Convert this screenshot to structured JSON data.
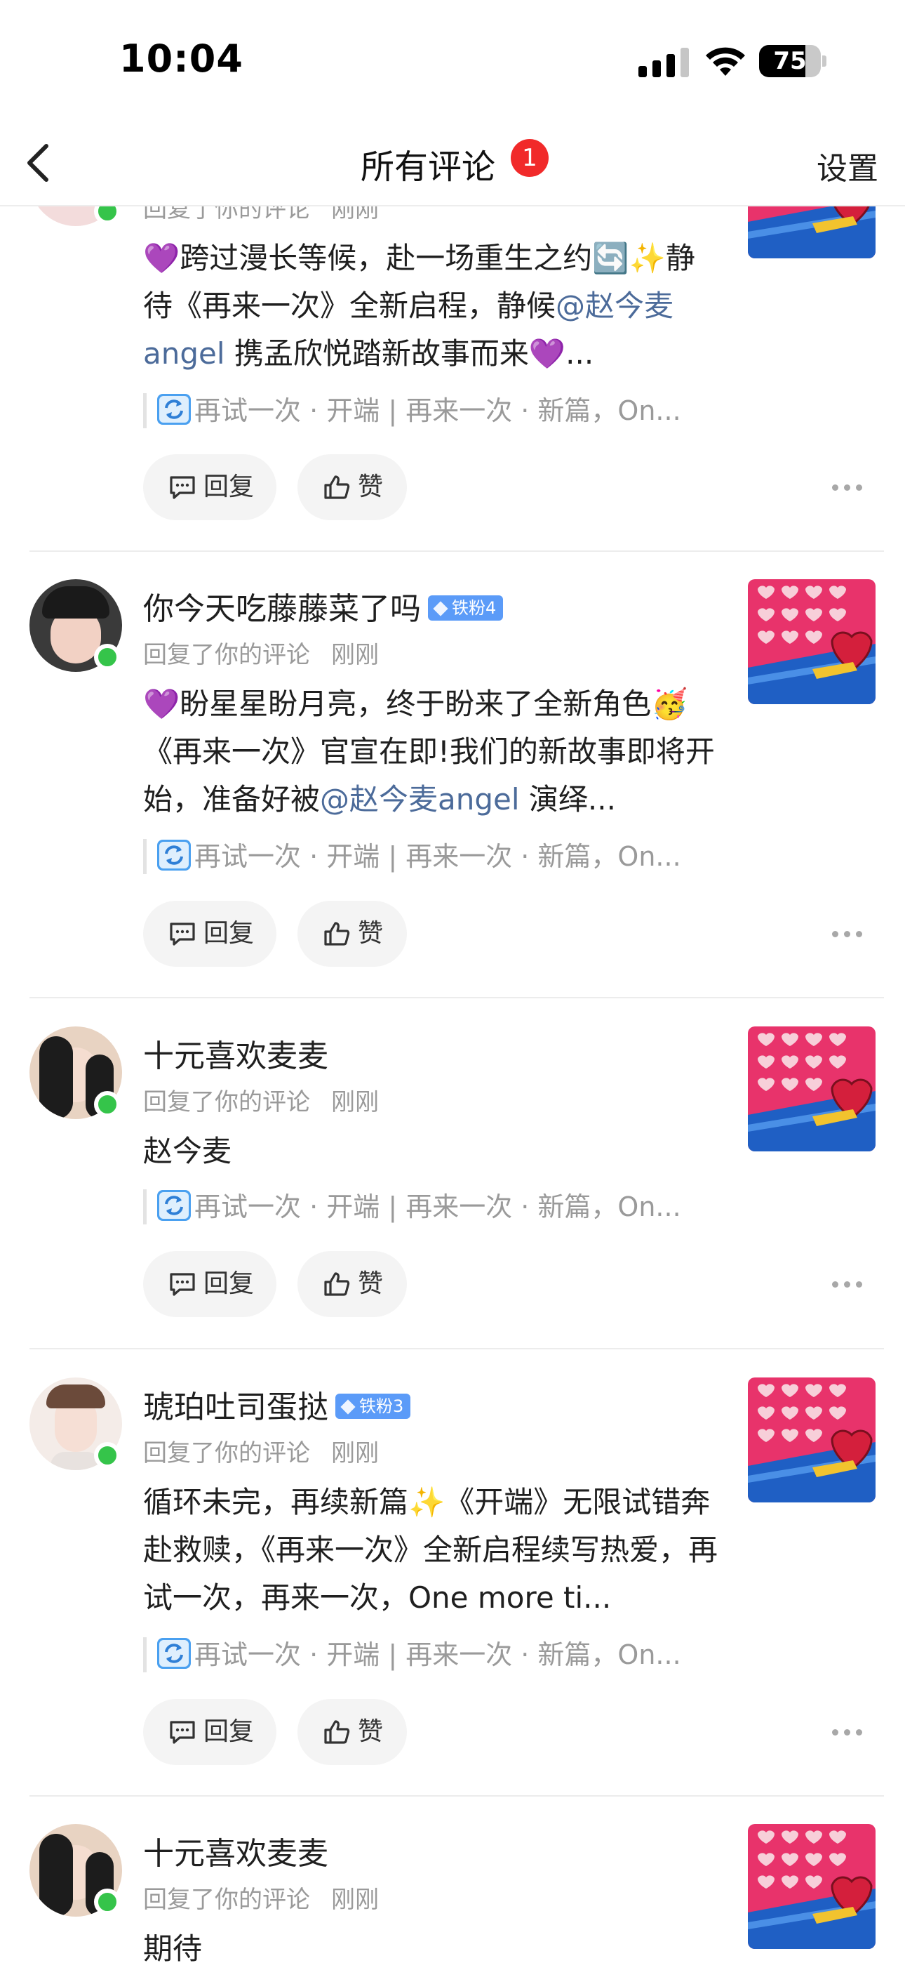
{
  "status_bar": {
    "time": "10:04",
    "battery": "75"
  },
  "nav": {
    "title": "所有评论",
    "badge": "1",
    "settings": "设置"
  },
  "top_partial": {
    "meta_reply": "回复了你的评论",
    "meta_time": "刚刚",
    "text_parts": [
      "💜跨过漫长等候，赴一场重生之约🔄✨静待《再来一次》全新启程，静候",
      "@赵今麦angel",
      "携孟欣悦踏新故事而来💜..."
    ],
    "quote": "再试一次 · 开端 | 再来一次 · 新篇，On...",
    "reply_label": "回复",
    "like_label": "赞"
  },
  "comments": [
    {
      "username": "你今天吃藤藤菜了吗",
      "fan_badge": "铁粉4",
      "meta_reply": "回复了你的评论",
      "meta_time": "刚刚",
      "text_parts": [
        "💜盼星星盼月亮，终于盼来了全新角色🥳《再来一次》官宣在即!我们的新故事即将开始，准备好被",
        "@赵今麦angel",
        "演绎..."
      ],
      "quote": "再试一次 · 开端 | 再来一次 · 新篇，On...",
      "reply_label": "回复",
      "like_label": "赞"
    },
    {
      "username": "十元喜欢麦麦",
      "fan_badge": "",
      "meta_reply": "回复了你的评论",
      "meta_time": "刚刚",
      "text_parts": [
        "赵今麦",
        "",
        ""
      ],
      "quote": "再试一次 · 开端 | 再来一次 · 新篇，On...",
      "reply_label": "回复",
      "like_label": "赞"
    },
    {
      "username": "琥珀吐司蛋挞",
      "fan_badge": "铁粉3",
      "meta_reply": "回复了你的评论",
      "meta_time": "刚刚",
      "text_parts": [
        "循环未完，再续新篇✨《开端》无限试错奔赴救赎，《再来一次》全新启程续写热爱，再试一次，再来一次，One more ti...",
        "",
        ""
      ],
      "quote": "再试一次 · 开端 | 再来一次 · 新篇，On...",
      "reply_label": "回复",
      "like_label": "赞"
    },
    {
      "username": "十元喜欢麦麦",
      "fan_badge": "",
      "meta_reply": "回复了你的评论",
      "meta_time": "刚刚",
      "text_parts": [
        "期待",
        "",
        ""
      ]
    }
  ],
  "colors": {
    "accent_link": "#4c6b9a",
    "badge_red": "#f12a2a",
    "online": "#35c44a",
    "fan_badge": "#5b9bf8",
    "thumb_pink": "#e8336b"
  },
  "icons": [
    "signal-icon",
    "wifi-icon",
    "battery-icon",
    "back-arrow-icon",
    "reply-icon",
    "thumbs-up-icon",
    "more-icon",
    "repeat-icon"
  ]
}
